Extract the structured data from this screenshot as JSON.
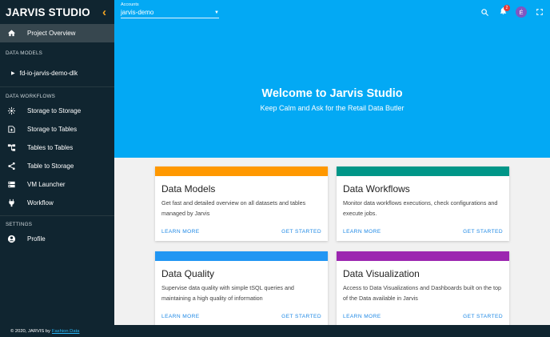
{
  "app": {
    "title": "JARVIS STUDIO"
  },
  "sidebar": {
    "active_item": "Project Overview",
    "sections": {
      "data_models": "DATA MODELS",
      "data_workflows": "DATA WORKFLOWS",
      "settings": "SETTINGS"
    },
    "tree_item": "fd-io-jarvis-demo-dlk",
    "workflow_items": [
      {
        "label": "Storage to Storage",
        "icon": "hub-icon"
      },
      {
        "label": "Storage to Tables",
        "icon": "note-add-icon"
      },
      {
        "label": "Tables to Tables",
        "icon": "account-tree-icon"
      },
      {
        "label": "Table to Storage",
        "icon": "share-icon"
      },
      {
        "label": "VM Launcher",
        "icon": "dns-icon"
      },
      {
        "label": "Workflow",
        "icon": "power-plug-icon"
      }
    ],
    "settings_items": [
      {
        "label": "Profile",
        "icon": "account-circle-icon"
      }
    ]
  },
  "header": {
    "account_label": "Accounts",
    "account_value": "jarvis-demo",
    "notification_count": "2",
    "avatar_letter": "É"
  },
  "hero": {
    "title": "Welcome to Jarvis Studio",
    "subtitle": "Keep Calm and Ask for the Retail Data Butler"
  },
  "cards": [
    {
      "title": "Data Models",
      "description": "Get fast and detailed overview on all datasets and tables managed by Jarvis",
      "color": "#ff9800",
      "learn": "LEARN MORE",
      "start": "GET STARTED"
    },
    {
      "title": "Data Workflows",
      "description": "Monitor data workflows executions, check configurations and execute jobs.",
      "color": "#009688",
      "learn": "LEARN MORE",
      "start": "GET STARTED"
    },
    {
      "title": "Data Quality",
      "description": "Supervise data quality with simple tSQL queries and maintaining a high quality of information",
      "color": "#2196f3",
      "learn": "LEARN MORE",
      "start": "GET STARTED"
    },
    {
      "title": "Data Visualization",
      "description": "Access to Data Visualizations and Dashboards built on the top of the Data available in Jarvis",
      "color": "#9c27b0",
      "learn": "LEARN MORE",
      "start": "GET STARTED"
    }
  ],
  "footer": {
    "text": "© 2020, JARVIS by",
    "link": "Fashion Data"
  },
  "colors": {
    "sidebar_bg": "#102530",
    "hero_bg": "#03a9f4",
    "accent": "#f5a623",
    "link": "#1e88e5"
  }
}
